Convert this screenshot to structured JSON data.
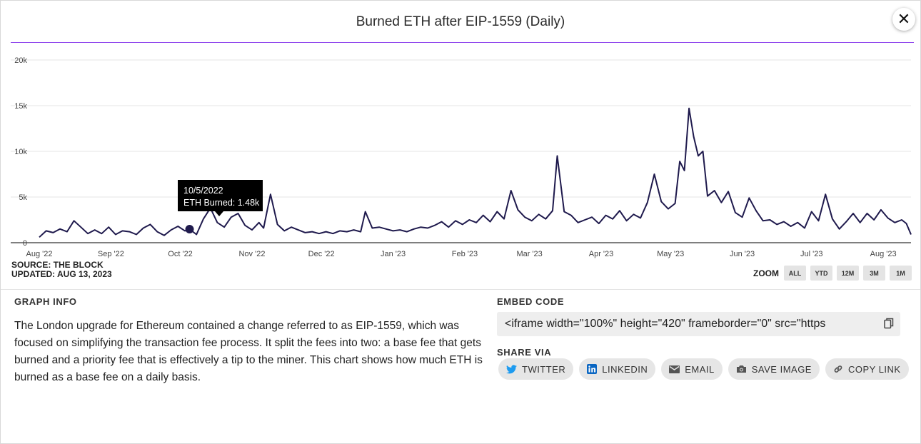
{
  "title": "Burned ETH after EIP-1559 (Daily)",
  "close_label": "✕",
  "source_line": "SOURCE: THE BLOCK",
  "updated_line": "UPDATED: AUG 13, 2023",
  "zoom": {
    "label": "ZOOM",
    "buttons": [
      "ALL",
      "YTD",
      "12M",
      "3M",
      "1M"
    ]
  },
  "graph_info": {
    "heading": "GRAPH INFO",
    "text": "The London upgrade for Ethereum contained a change referred to as EIP-1559, which was focused on simplifying the transaction fee process. It split the fees into two: a base fee that gets burned and a priority fee that is effectively a tip to the miner. This chart shows how much ETH is burned as a base fee on a daily basis."
  },
  "embed": {
    "heading": "EMBED CODE",
    "code": "<iframe width=\"100%\" height=\"420\" frameborder=\"0\" src=\"https",
    "copy_icon": "copy-icon"
  },
  "share": {
    "heading": "SHARE VIA",
    "buttons": [
      {
        "label": "TWITTER",
        "icon": "twitter-icon"
      },
      {
        "label": "LINKEDIN",
        "icon": "linkedin-icon"
      },
      {
        "label": "EMAIL",
        "icon": "email-icon"
      },
      {
        "label": "SAVE IMAGE",
        "icon": "camera-icon"
      },
      {
        "label": "COPY LINK",
        "icon": "link-icon"
      }
    ]
  },
  "colors": {
    "line": "#1f1a4d",
    "accent_rule": "#8e44ec",
    "tooltip_bg": "#000000",
    "grid": "#e6e6e6"
  },
  "chart_data": {
    "type": "line",
    "title": "Burned ETH after EIP-1559 (Daily)",
    "x_start": "2022-08-01",
    "x_end": "2023-08-13",
    "ylim": [
      0,
      20000
    ],
    "y_ticks": [
      0,
      5000,
      10000,
      15000,
      20000
    ],
    "y_tick_labels": [
      "0",
      "5k",
      "10k",
      "15k",
      "20k"
    ],
    "x_ticks": [
      {
        "date": "2022-08-01",
        "label": "Aug '22"
      },
      {
        "date": "2022-09-01",
        "label": "Sep '22"
      },
      {
        "date": "2022-10-01",
        "label": "Oct '22"
      },
      {
        "date": "2022-11-01",
        "label": "Nov '22"
      },
      {
        "date": "2022-12-01",
        "label": "Dec '22"
      },
      {
        "date": "2023-01-01",
        "label": "Jan '23"
      },
      {
        "date": "2023-02-01",
        "label": "Feb '23"
      },
      {
        "date": "2023-03-01",
        "label": "Mar '23"
      },
      {
        "date": "2023-04-01",
        "label": "Apr '23"
      },
      {
        "date": "2023-05-01",
        "label": "May '23"
      },
      {
        "date": "2023-06-01",
        "label": "Jun '23"
      },
      {
        "date": "2023-07-01",
        "label": "Jul '23"
      },
      {
        "date": "2023-08-01",
        "label": "Aug '23"
      }
    ],
    "grid": true,
    "legend": "none",
    "tooltip": {
      "date": "10/5/2022",
      "text": "ETH Burned: 1.48k",
      "x": "2022-10-05",
      "y": 1480
    },
    "series": [
      {
        "points": [
          [
            "2022-08-01",
            600
          ],
          [
            "2022-08-04",
            1300
          ],
          [
            "2022-08-07",
            1100
          ],
          [
            "2022-08-10",
            1500
          ],
          [
            "2022-08-13",
            1200
          ],
          [
            "2022-08-16",
            2400
          ],
          [
            "2022-08-19",
            1700
          ],
          [
            "2022-08-22",
            1000
          ],
          [
            "2022-08-25",
            1400
          ],
          [
            "2022-08-28",
            1000
          ],
          [
            "2022-08-31",
            1700
          ],
          [
            "2022-09-03",
            900
          ],
          [
            "2022-09-06",
            1300
          ],
          [
            "2022-09-09",
            1200
          ],
          [
            "2022-09-12",
            900
          ],
          [
            "2022-09-15",
            1600
          ],
          [
            "2022-09-18",
            2000
          ],
          [
            "2022-09-21",
            1200
          ],
          [
            "2022-09-24",
            800
          ],
          [
            "2022-09-27",
            1400
          ],
          [
            "2022-09-30",
            1800
          ],
          [
            "2022-10-03",
            1300
          ],
          [
            "2022-10-05",
            1480
          ],
          [
            "2022-10-08",
            900
          ],
          [
            "2022-10-11",
            2600
          ],
          [
            "2022-10-14",
            3800
          ],
          [
            "2022-10-17",
            2200
          ],
          [
            "2022-10-20",
            1700
          ],
          [
            "2022-10-23",
            2800
          ],
          [
            "2022-10-26",
            3200
          ],
          [
            "2022-10-29",
            1900
          ],
          [
            "2022-11-01",
            1400
          ],
          [
            "2022-11-04",
            2200
          ],
          [
            "2022-11-06",
            1600
          ],
          [
            "2022-11-09",
            5300
          ],
          [
            "2022-11-12",
            2000
          ],
          [
            "2022-11-15",
            1300
          ],
          [
            "2022-11-18",
            1700
          ],
          [
            "2022-11-21",
            1400
          ],
          [
            "2022-11-24",
            1100
          ],
          [
            "2022-11-27",
            1200
          ],
          [
            "2022-11-30",
            1000
          ],
          [
            "2022-12-03",
            1200
          ],
          [
            "2022-12-06",
            1000
          ],
          [
            "2022-12-09",
            1300
          ],
          [
            "2022-12-12",
            1200
          ],
          [
            "2022-12-15",
            1400
          ],
          [
            "2022-12-18",
            1200
          ],
          [
            "2022-12-20",
            3400
          ],
          [
            "2022-12-23",
            1600
          ],
          [
            "2022-12-26",
            1700
          ],
          [
            "2022-12-29",
            1500
          ],
          [
            "2023-01-01",
            1300
          ],
          [
            "2023-01-04",
            1400
          ],
          [
            "2023-01-07",
            1200
          ],
          [
            "2023-01-10",
            1500
          ],
          [
            "2023-01-13",
            1700
          ],
          [
            "2023-01-16",
            1600
          ],
          [
            "2023-01-19",
            1900
          ],
          [
            "2023-01-22",
            2300
          ],
          [
            "2023-01-25",
            1700
          ],
          [
            "2023-01-28",
            2400
          ],
          [
            "2023-01-31",
            2000
          ],
          [
            "2023-02-03",
            2500
          ],
          [
            "2023-02-06",
            2200
          ],
          [
            "2023-02-09",
            3000
          ],
          [
            "2023-02-12",
            2300
          ],
          [
            "2023-02-15",
            3400
          ],
          [
            "2023-02-18",
            2600
          ],
          [
            "2023-02-21",
            5700
          ],
          [
            "2023-02-24",
            3600
          ],
          [
            "2023-02-27",
            2800
          ],
          [
            "2023-03-02",
            2400
          ],
          [
            "2023-03-05",
            3100
          ],
          [
            "2023-03-08",
            2600
          ],
          [
            "2023-03-11",
            3500
          ],
          [
            "2023-03-13",
            9500
          ],
          [
            "2023-03-16",
            3400
          ],
          [
            "2023-03-19",
            3000
          ],
          [
            "2023-03-22",
            2200
          ],
          [
            "2023-03-25",
            2500
          ],
          [
            "2023-03-28",
            2800
          ],
          [
            "2023-03-31",
            2100
          ],
          [
            "2023-04-03",
            3000
          ],
          [
            "2023-04-06",
            2600
          ],
          [
            "2023-04-09",
            3500
          ],
          [
            "2023-04-12",
            2400
          ],
          [
            "2023-04-15",
            3100
          ],
          [
            "2023-04-18",
            2700
          ],
          [
            "2023-04-21",
            4400
          ],
          [
            "2023-04-24",
            7500
          ],
          [
            "2023-04-27",
            4500
          ],
          [
            "2023-04-30",
            3700
          ],
          [
            "2023-05-03",
            4300
          ],
          [
            "2023-05-05",
            8900
          ],
          [
            "2023-05-07",
            7900
          ],
          [
            "2023-05-09",
            14700
          ],
          [
            "2023-05-11",
            11600
          ],
          [
            "2023-05-13",
            9500
          ],
          [
            "2023-05-15",
            10000
          ],
          [
            "2023-05-17",
            5100
          ],
          [
            "2023-05-20",
            5700
          ],
          [
            "2023-05-23",
            4400
          ],
          [
            "2023-05-26",
            5600
          ],
          [
            "2023-05-29",
            3300
          ],
          [
            "2023-06-01",
            2800
          ],
          [
            "2023-06-04",
            4900
          ],
          [
            "2023-06-07",
            3500
          ],
          [
            "2023-06-10",
            2400
          ],
          [
            "2023-06-13",
            2500
          ],
          [
            "2023-06-16",
            2000
          ],
          [
            "2023-06-19",
            2300
          ],
          [
            "2023-06-22",
            1800
          ],
          [
            "2023-06-25",
            2200
          ],
          [
            "2023-06-28",
            1600
          ],
          [
            "2023-07-01",
            3400
          ],
          [
            "2023-07-04",
            2400
          ],
          [
            "2023-07-07",
            5300
          ],
          [
            "2023-07-10",
            2600
          ],
          [
            "2023-07-13",
            1500
          ],
          [
            "2023-07-16",
            2300
          ],
          [
            "2023-07-19",
            3200
          ],
          [
            "2023-07-22",
            2200
          ],
          [
            "2023-07-25",
            3200
          ],
          [
            "2023-07-28",
            2500
          ],
          [
            "2023-07-31",
            3600
          ],
          [
            "2023-08-03",
            2700
          ],
          [
            "2023-08-06",
            2200
          ],
          [
            "2023-08-09",
            2500
          ],
          [
            "2023-08-11",
            2100
          ],
          [
            "2023-08-13",
            900
          ]
        ]
      }
    ]
  }
}
